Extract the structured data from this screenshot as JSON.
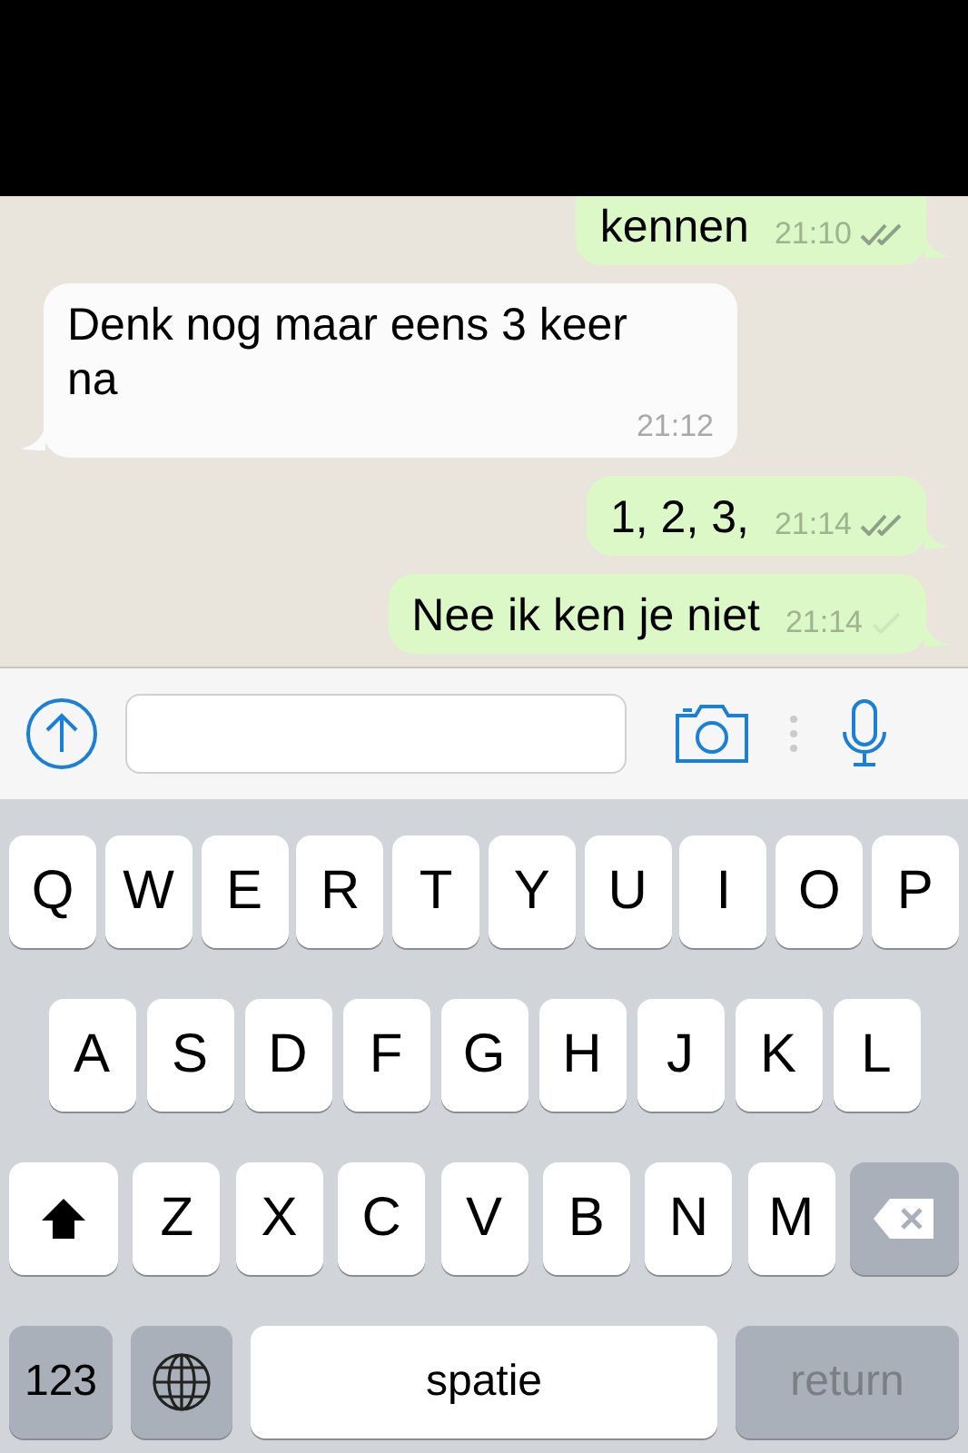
{
  "messages": [
    {
      "outgoing": true,
      "text": "kennen",
      "time": "21:10",
      "read": true,
      "cut": true
    },
    {
      "outgoing": false,
      "text": "Denk nog maar eens 3 keer na",
      "time": "21:12"
    },
    {
      "outgoing": true,
      "text": "1, 2, 3,",
      "time": "21:14",
      "read": true
    },
    {
      "outgoing": true,
      "text": "Nee ik ken je niet",
      "time": "21:14",
      "read": false
    }
  ],
  "keyboard": {
    "letter_rows": [
      [
        {
          "kind": "letter",
          "label": "Q"
        },
        {
          "kind": "letter",
          "label": "W"
        },
        {
          "kind": "letter",
          "label": "E"
        },
        {
          "kind": "letter",
          "label": "R"
        },
        {
          "kind": "letter",
          "label": "T"
        },
        {
          "kind": "letter",
          "label": "Y"
        },
        {
          "kind": "letter",
          "label": "U"
        },
        {
          "kind": "letter",
          "label": "I"
        },
        {
          "kind": "letter",
          "label": "O"
        },
        {
          "kind": "letter",
          "label": "P"
        }
      ],
      [
        {
          "kind": "letter",
          "label": "A"
        },
        {
          "kind": "letter",
          "label": "S"
        },
        {
          "kind": "letter",
          "label": "D"
        },
        {
          "kind": "letter",
          "label": "F"
        },
        {
          "kind": "letter",
          "label": "G"
        },
        {
          "kind": "letter",
          "label": "H"
        },
        {
          "kind": "letter",
          "label": "J"
        },
        {
          "kind": "letter",
          "label": "K"
        },
        {
          "kind": "letter",
          "label": "L"
        }
      ],
      [
        {
          "kind": "shift"
        },
        {
          "kind": "letter",
          "label": "Z"
        },
        {
          "kind": "letter",
          "label": "X"
        },
        {
          "kind": "letter",
          "label": "C"
        },
        {
          "kind": "letter",
          "label": "V"
        },
        {
          "kind": "letter",
          "label": "B"
        },
        {
          "kind": "letter",
          "label": "N"
        },
        {
          "kind": "letter",
          "label": "M"
        },
        {
          "kind": "delete"
        }
      ]
    ],
    "bottom_row": [
      {
        "kind": "numbers",
        "label": "123"
      },
      {
        "kind": "globe"
      },
      {
        "kind": "space",
        "label": "spatie"
      },
      {
        "kind": "return",
        "label": "return"
      }
    ]
  }
}
